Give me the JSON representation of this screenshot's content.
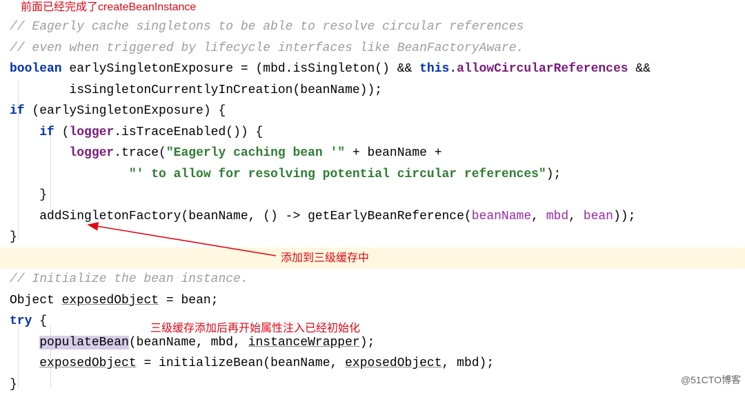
{
  "annotations": {
    "top": "前面已经完成了createBeanInstance",
    "arrow_label": "添加到三级缓存中",
    "populate_label": "三级缓存添加后再开始属性注入已经初始化"
  },
  "code": {
    "c1": "// Eagerly cache singletons to be able to resolve circular references",
    "c2": "// even when triggered by lifecycle interfaces like BeanFactoryAware.",
    "l3": {
      "kw": "boolean",
      "t1": " earlySingletonExposure = (mbd.isSingleton() && ",
      "kw2": "this",
      "t2": ".",
      "fld": "allowCircularReferences",
      "t3": " &&"
    },
    "l4": "        isSingletonCurrentlyInCreation(beanName));",
    "l5": {
      "kw": "if",
      "body": " (earlySingletonExposure) {"
    },
    "l6": {
      "kw": "if",
      "t1": " (",
      "fld": "logger",
      "t2": ".isTraceEnabled()) {"
    },
    "l7": {
      "fld": "logger",
      "t1": ".trace(",
      "s": "\"Eagerly caching bean '\"",
      "t2": " + beanName +"
    },
    "l8": {
      "s": "\"' to allow for resolving potential circular references\"",
      "t1": ");"
    },
    "l9": "    }",
    "l10": {
      "t1": "    addSingletonFactory(beanName, () -> getEarlyBeanReference(",
      "p1": "beanName",
      "c1": ", ",
      "p2": "mbd",
      "c2": ", ",
      "p3": "bean",
      "t2": "));"
    },
    "l11": "}",
    "c3": "// Initialize the bean instance.",
    "l13": {
      "t1": "Object ",
      "u1": "exposedObject",
      "t2": " = bean;"
    },
    "l14": {
      "kw": "try",
      "body": " {"
    },
    "l15": {
      "hl": "populateBean",
      "t1": "(beanName, mbd, ",
      "u1": "instanceWrapper",
      "t2": ");"
    },
    "l16": {
      "u1": "exposedObject",
      "t1": " = initializeBean(beanName, ",
      "u2": "exposedObject",
      "t2": ", mbd);"
    },
    "l17": "}"
  },
  "watermark": "@51CTO博客"
}
